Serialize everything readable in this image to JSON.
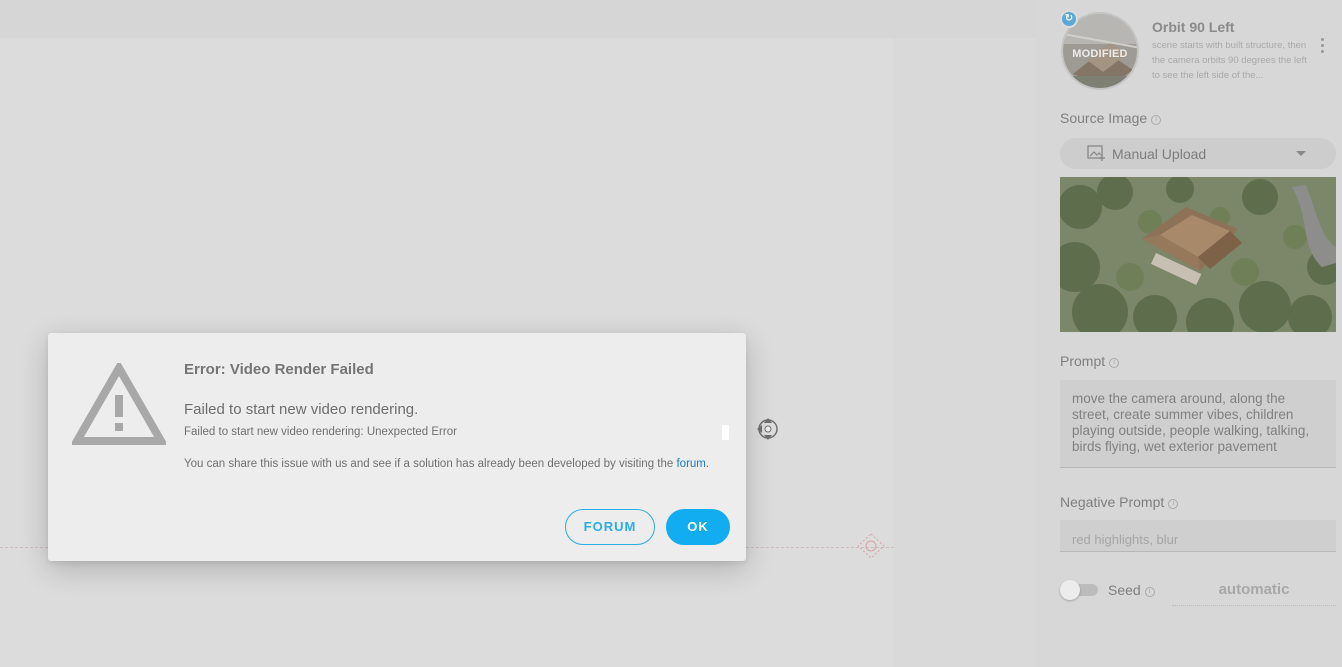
{
  "preset": {
    "badge": "MODIFIED",
    "title": "Orbit 90 Left",
    "description": "scene starts with built structure, then the camera orbits 90 degrees the left to see the left side of the..."
  },
  "source_image": {
    "label": "Source Image",
    "selected": "Manual Upload"
  },
  "prompt": {
    "label": "Prompt",
    "value": "move the camera around, along the street, create summer vibes, children playing outside, people walking, talking, birds flying, wet exterior pavement"
  },
  "negative_prompt": {
    "label": "Negative Prompt",
    "value": "red highlights, blur"
  },
  "seed": {
    "label": "Seed",
    "value": "automatic",
    "enabled": false
  },
  "dialog": {
    "title": "Error: Video Render Failed",
    "message": "Failed to start new video rendering.",
    "detail": "Failed to start new video rendering: Unexpected Error",
    "share_text": "You can share this issue with us and see if a solution has already been developed by visiting the ",
    "share_link": "forum",
    "share_end": ".",
    "forum_button": "FORUM",
    "ok_button": "OK"
  },
  "colors": {
    "accent": "#12adf0",
    "link": "#1a7bc9"
  }
}
